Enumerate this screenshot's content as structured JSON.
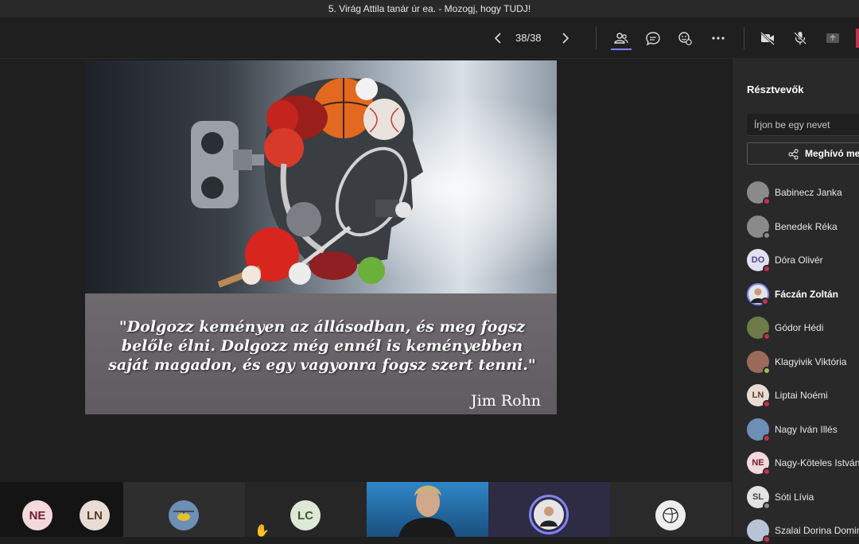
{
  "window": {
    "title": "5. Virág Attila tanár úr ea. - Mozogj, hogy TUDJ!"
  },
  "toolbar": {
    "page_count": "38/38",
    "icons": [
      "chevron-left-icon",
      "chevron-right-icon",
      "people-icon",
      "chat-icon",
      "reactions-icon",
      "more-icon",
      "camera-off-icon",
      "mic-off-icon",
      "share-icon"
    ],
    "accent": "#7f85f5"
  },
  "slide": {
    "quote": "\"Dolgozz keményen az állásodban, és meg fogsz belőle élni. Dolgozz még ennél is keményebben saját magadon, és egy vagyonra fogsz szert tenni.\"",
    "author": "Jim Rohn"
  },
  "gallery": {
    "tiles": [
      {
        "initials": "NE"
      },
      {
        "initials": "LN"
      },
      {
        "initials": ""
      },
      {
        "initials": "LC"
      },
      {
        "initials": ""
      },
      {
        "initials": ""
      },
      {
        "initials": ""
      }
    ],
    "raised_hand_icon": "raised-hand-icon"
  },
  "panel": {
    "title": "Résztvevők",
    "search_placeholder": "Írjon be egy nevet",
    "invite_label": "Meghívó me",
    "participants": [
      {
        "name": "Babinecz Janka",
        "initials": "",
        "status": "busy"
      },
      {
        "name": "Benedek Réka",
        "initials": "",
        "status": "away"
      },
      {
        "name": "Dóra Olivér",
        "initials": "DO",
        "status": "busy"
      },
      {
        "name": "Fáczán Zoltán",
        "initials": "",
        "status": "busy"
      },
      {
        "name": "Gódor Hédi",
        "initials": "",
        "status": "busy"
      },
      {
        "name": "Klagyivik Viktória",
        "initials": "",
        "status": "available"
      },
      {
        "name": "Liptai Noémi",
        "initials": "LN",
        "status": "busy"
      },
      {
        "name": "Nagy Iván Illés",
        "initials": "",
        "status": "busy"
      },
      {
        "name": "Nagy-Köteles István",
        "initials": "NE",
        "status": "busy"
      },
      {
        "name": "Sóti Lívia",
        "initials": "SL",
        "status": "away"
      },
      {
        "name": "Szalai Dorina Domin",
        "initials": "",
        "status": "busy"
      }
    ],
    "status_colors": {
      "busy": "#c4314b",
      "available": "#92c353",
      "away": "#8a8a8a"
    }
  }
}
